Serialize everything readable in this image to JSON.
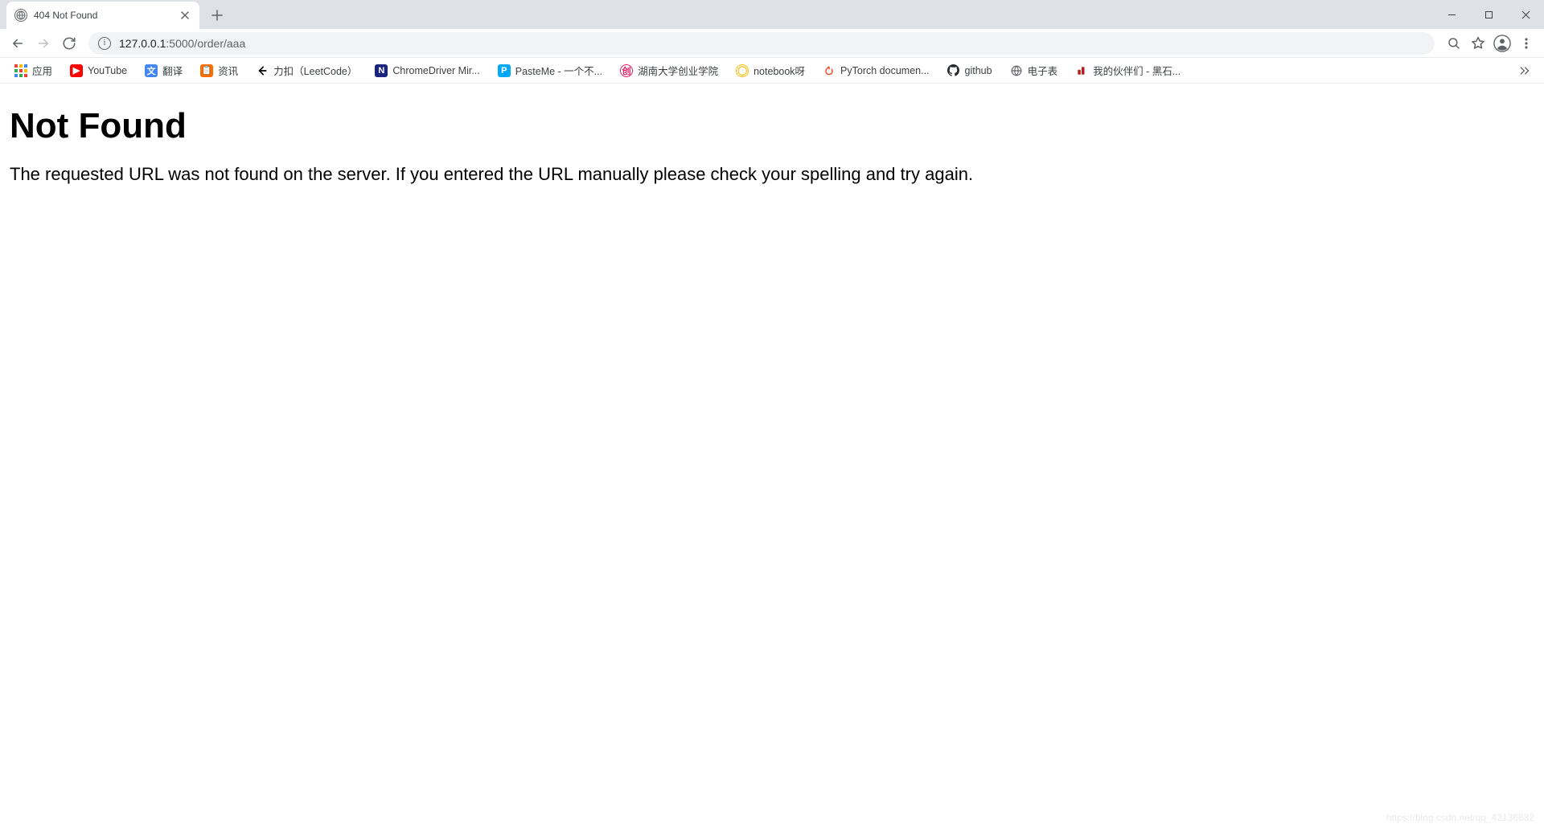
{
  "tab": {
    "title": "404 Not Found"
  },
  "address": {
    "host": "127.0.0.1",
    "port_path": ":5000/order/aaa"
  },
  "bookmarks": {
    "apps": "应用",
    "items": [
      {
        "label": "YouTube"
      },
      {
        "label": "翻译"
      },
      {
        "label": "资讯"
      },
      {
        "label": "力扣（LeetCode）"
      },
      {
        "label": "ChromeDriver Mir..."
      },
      {
        "label": "PasteMe - 一个不..."
      },
      {
        "label": "湖南大学创业学院"
      },
      {
        "label": "notebook呀"
      },
      {
        "label": "PyTorch documen..."
      },
      {
        "label": "github"
      },
      {
        "label": "电子表"
      },
      {
        "label": "我的伙伴们 - 黑石..."
      }
    ]
  },
  "page": {
    "heading": "Not Found",
    "message": "The requested URL was not found on the server. If you entered the URL manually please check your spelling and try again."
  },
  "watermark": "https://blog.csdn.net/qq_42136832"
}
